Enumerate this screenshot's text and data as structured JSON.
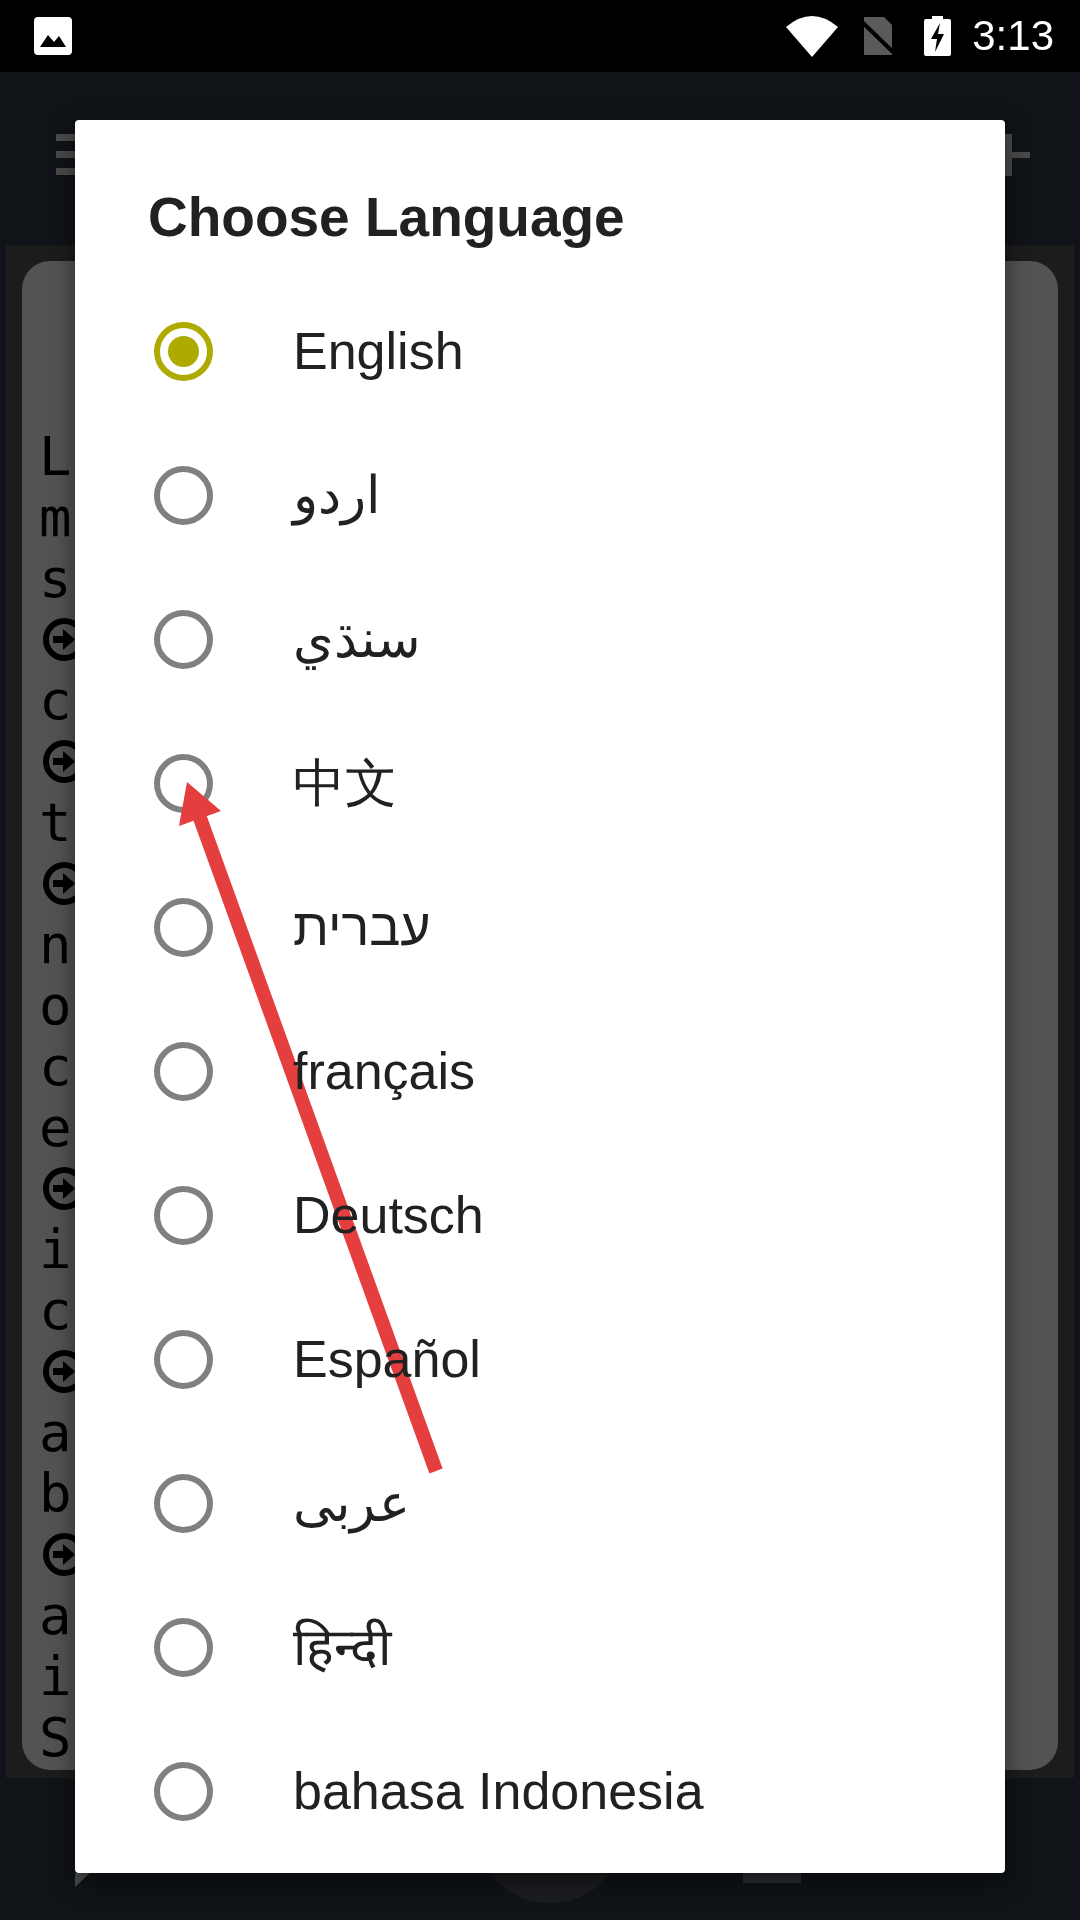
{
  "status_bar": {
    "time": "3:13"
  },
  "background": {
    "lines": [
      {
        "kind": "text",
        "text": "L"
      },
      {
        "kind": "text",
        "text": "m"
      },
      {
        "kind": "text",
        "text": "s"
      },
      {
        "kind": "bullet"
      },
      {
        "kind": "text",
        "text": "c"
      },
      {
        "kind": "bullet"
      },
      {
        "kind": "text",
        "text": "t"
      },
      {
        "kind": "bullet"
      },
      {
        "kind": "text",
        "text": "n"
      },
      {
        "kind": "text",
        "text": "o"
      },
      {
        "kind": "text",
        "text": "c"
      },
      {
        "kind": "text",
        "text": "e"
      },
      {
        "kind": "bullet"
      },
      {
        "kind": "text",
        "text": "i"
      },
      {
        "kind": "text",
        "text": "c"
      },
      {
        "kind": "bullet"
      },
      {
        "kind": "text",
        "text": "a"
      },
      {
        "kind": "text",
        "text": "b"
      },
      {
        "kind": "bullet"
      },
      {
        "kind": "text",
        "text": "a"
      },
      {
        "kind": "text",
        "text": "i"
      },
      {
        "kind": "text",
        "text": "S"
      }
    ]
  },
  "dialog": {
    "title": "Choose Language",
    "options": [
      {
        "label": "English",
        "selected": true
      },
      {
        "label": "اردو",
        "selected": false
      },
      {
        "label": "سنڌي",
        "selected": false
      },
      {
        "label": "中文",
        "selected": false
      },
      {
        "label": "עברית",
        "selected": false
      },
      {
        "label": "français",
        "selected": false
      },
      {
        "label": "Deutsch",
        "selected": false
      },
      {
        "label": "Español",
        "selected": false
      },
      {
        "label": "عربى",
        "selected": false
      },
      {
        "label": "हिन्दी",
        "selected": false
      },
      {
        "label": "bahasa Indonesia",
        "selected": false
      }
    ]
  }
}
